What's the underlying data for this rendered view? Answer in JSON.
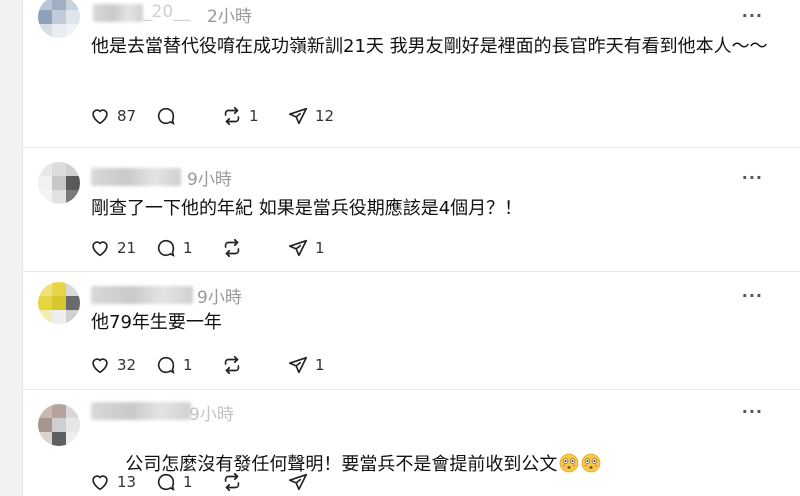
{
  "posts": [
    {
      "name_visible": "_20__",
      "time": "2小時",
      "text": "他是去當替代役唷在成功嶺新訓21天 我男友剛好是裡面的長官昨天有看到他本人〜〜",
      "likes": "87",
      "comments": "",
      "reposts": "1",
      "shares": "12"
    },
    {
      "name_visible": "",
      "time": "9小時",
      "text": "剛查了一下他的年紀 如果是當兵役期應該是4個月？！",
      "likes": "21",
      "comments": "1",
      "reposts": "",
      "shares": "1"
    },
    {
      "name_visible": "",
      "time": "9小時",
      "text": "他79年生要一年",
      "likes": "32",
      "comments": "1",
      "reposts": "",
      "shares": "1"
    },
    {
      "name_visible": "",
      "time": "9小時",
      "text": "公司怎麼沒有發任何聲明！要當兵不是會提前收到公文",
      "likes": "13",
      "comments": "1",
      "reposts": "",
      "shares": ""
    }
  ],
  "icons": {
    "like": "heart-icon",
    "comment": "comment-bubble-icon",
    "repost": "repost-arrows-icon",
    "share": "send-icon",
    "more": "more-dots-icon",
    "emoji": "flushed-face-emoji"
  },
  "more_label": "···"
}
